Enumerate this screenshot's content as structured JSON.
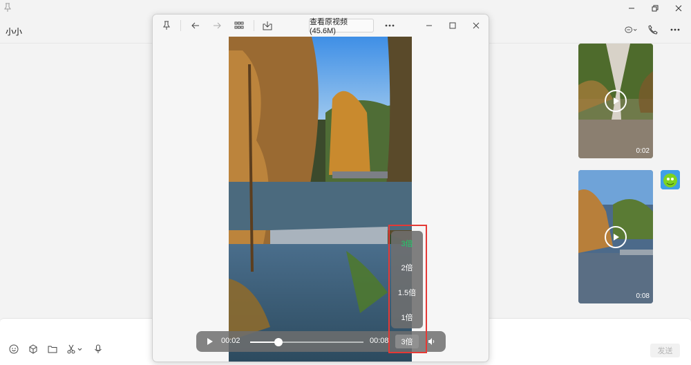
{
  "chat": {
    "title": "小小",
    "thumbs": [
      {
        "duration": "0:02"
      },
      {
        "duration": "0:08"
      }
    ],
    "send_label": "发送"
  },
  "viewer": {
    "original_button": "查看原视频(45.6M)",
    "current_time": "00:02",
    "total_time": "00:08",
    "progress": 0.25,
    "speed_button": "3倍",
    "speed_options": [
      {
        "label": "3倍",
        "active": true
      },
      {
        "label": "2倍",
        "active": false
      },
      {
        "label": "1.5倍",
        "active": false
      },
      {
        "label": "1倍",
        "active": false
      }
    ]
  },
  "colors": {
    "active_speed": "#1fcf6c",
    "highlight_box": "#e53935"
  }
}
